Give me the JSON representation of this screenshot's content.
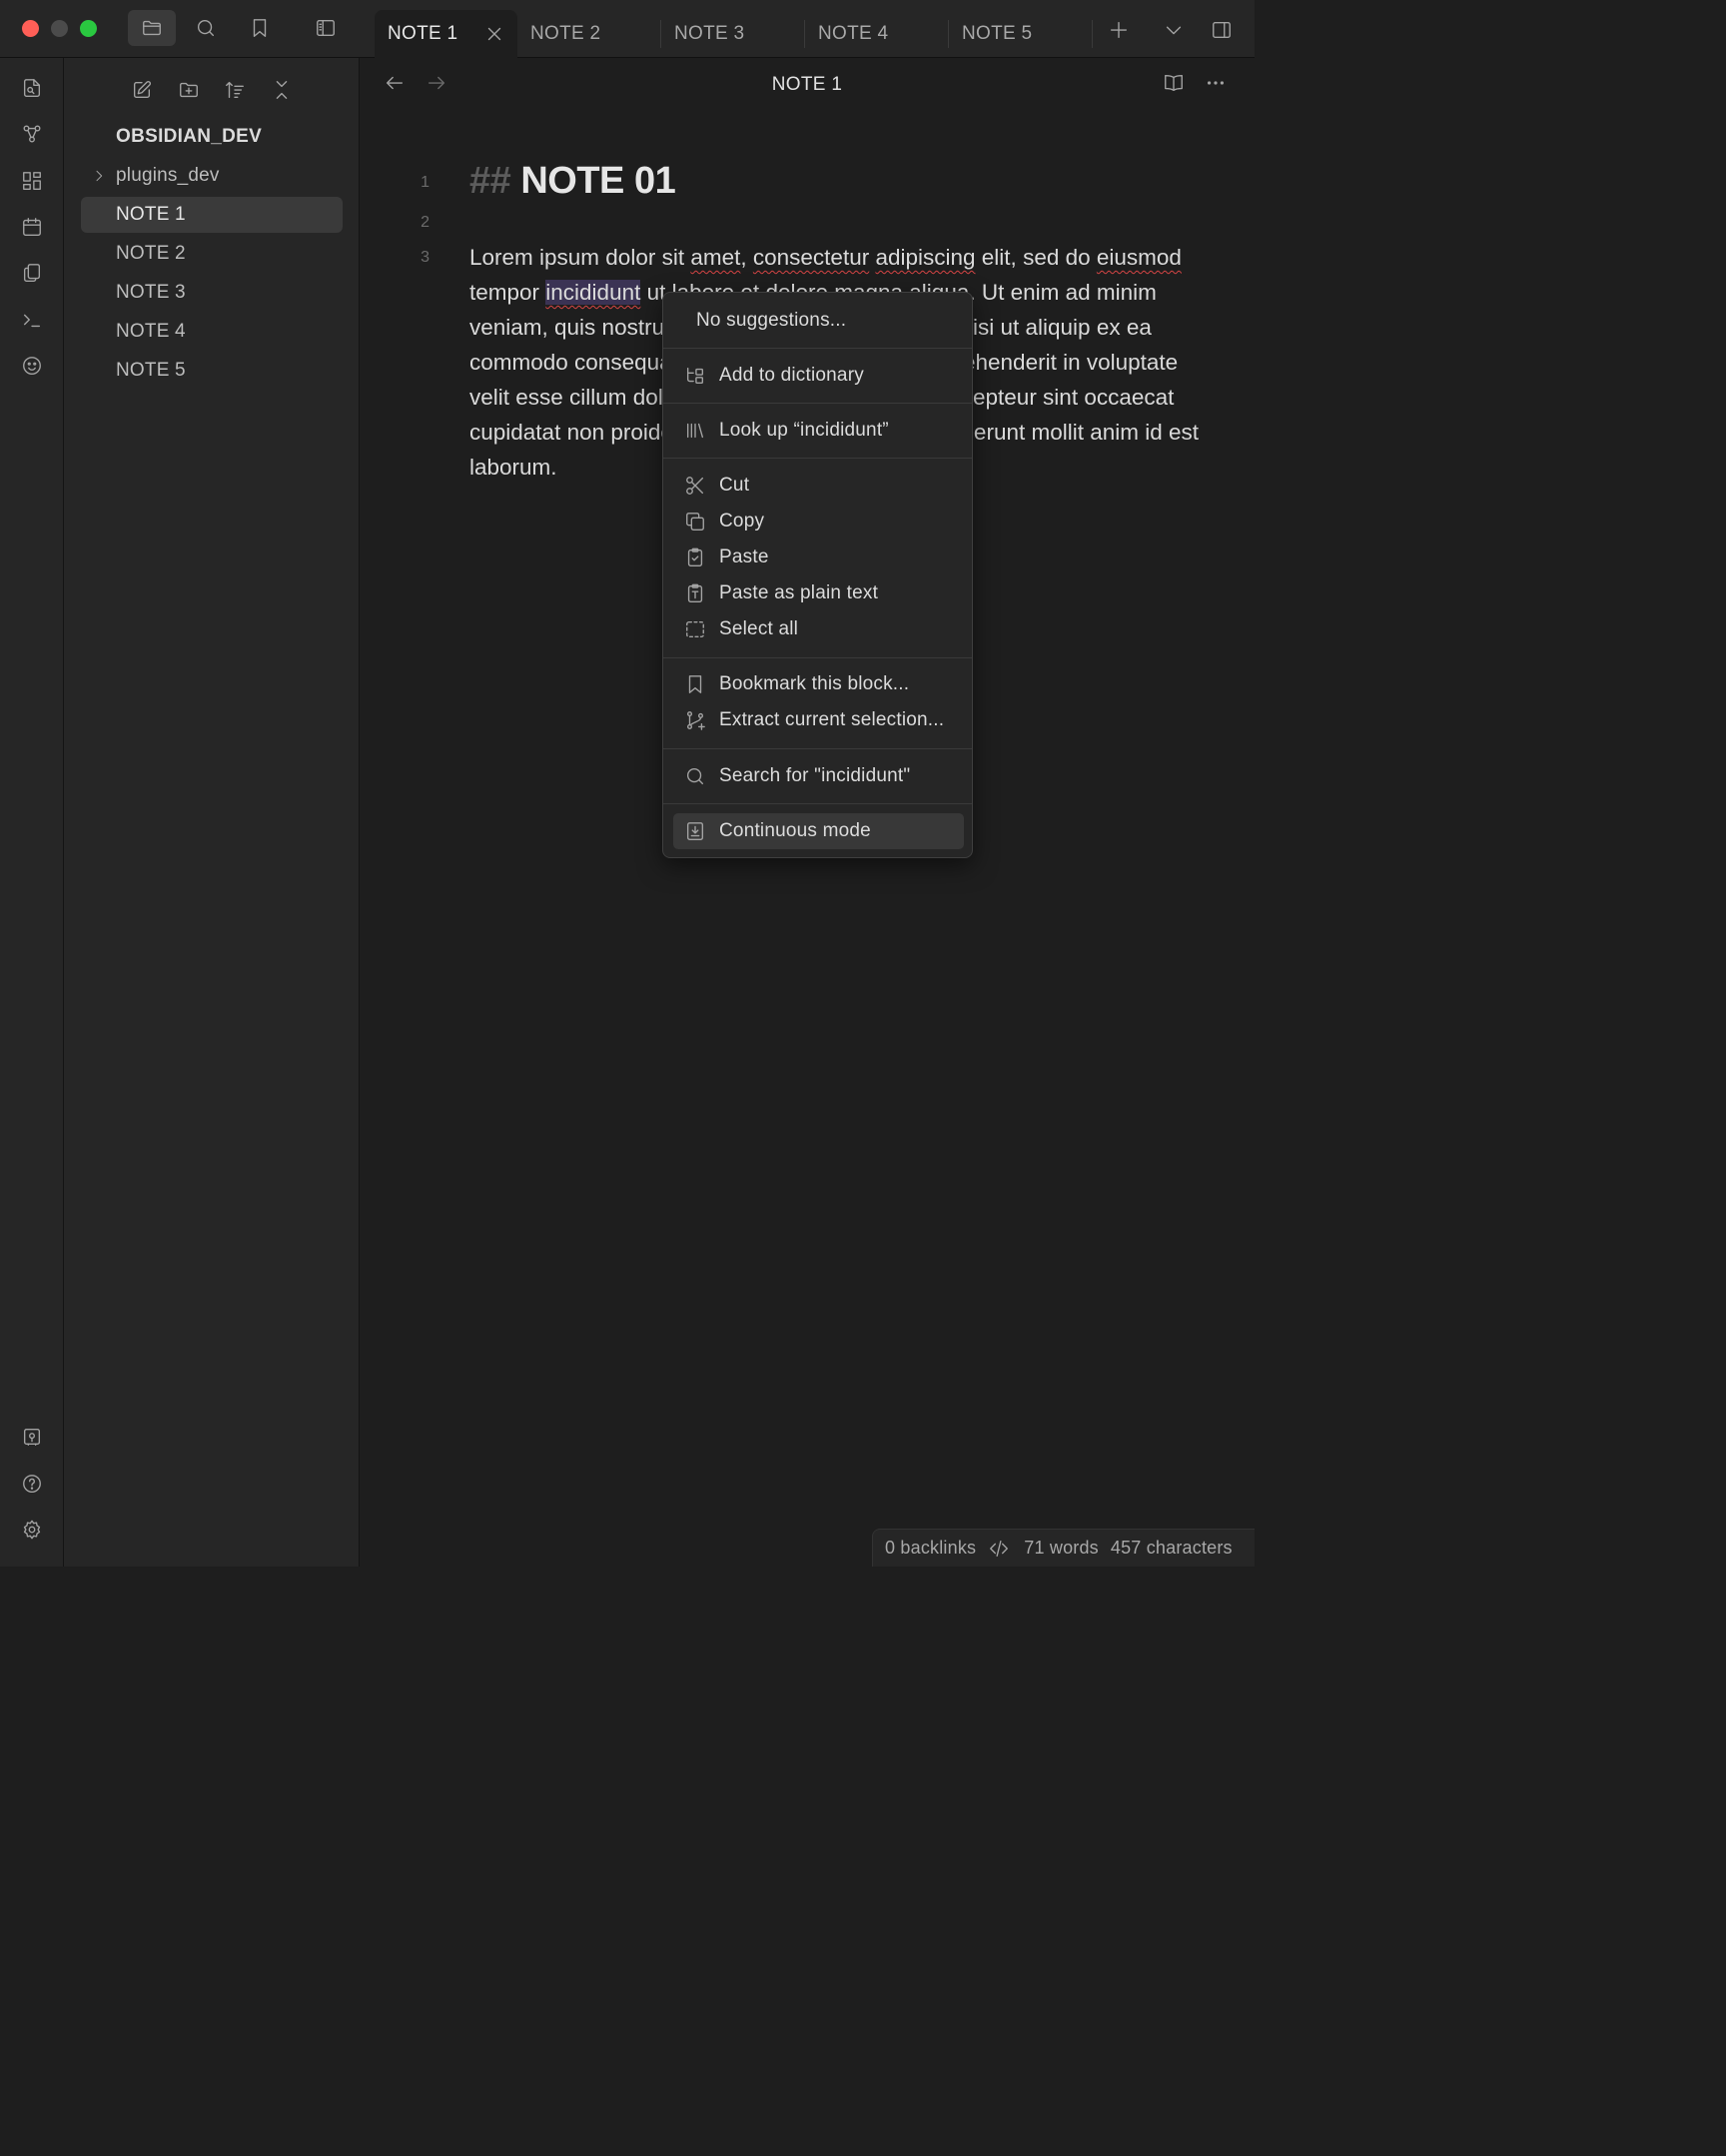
{
  "tabs": [
    {
      "label": "NOTE 1"
    },
    {
      "label": "NOTE 2"
    },
    {
      "label": "NOTE 3"
    },
    {
      "label": "NOTE 4"
    },
    {
      "label": "NOTE 5"
    }
  ],
  "sidebar": {
    "vault_name": "OBSIDIAN_DEV",
    "folder": "plugins_dev",
    "files": [
      "NOTE 1",
      "NOTE 2",
      "NOTE 3",
      "NOTE 4",
      "NOTE 5"
    ]
  },
  "editor": {
    "title": "NOTE 1",
    "line_numbers": [
      "1",
      "2",
      "3"
    ],
    "heading_marker": "##",
    "heading_text": "NOTE 01",
    "body": {
      "t1": "Lorem ipsum dolor sit ",
      "w_amet": "amet",
      "t2": ", ",
      "w_consectetur": "consectetur",
      "t3": " ",
      "w_adipiscing": "adipiscing",
      "t4": " elit, sed do ",
      "w_eiusmod": "eiusmod",
      "t5": " tempor ",
      "w_incididunt": "incididunt",
      "t6": " ut labore et dolore magna ",
      "w_aliqua": "aliqua",
      "t7": ". Ut enim ad minim veniam, quis nostrud exercitation ullamco laboris nisi ut aliquip ex ea commodo consequat. Duis aute irure dolor in reprehenderit in voluptate velit esse cillum dolore eu fugiat nulla pariatur. Excepteur sint occaecat cupidatat non proident, sunt in culpa qui officia deserunt mollit anim id est laborum."
    }
  },
  "context_menu": {
    "no_suggestions": "No suggestions...",
    "add_to_dictionary": "Add to dictionary",
    "look_up": "Look up “incididunt”",
    "cut": "Cut",
    "copy": "Copy",
    "paste": "Paste",
    "paste_plain": "Paste as plain text",
    "select_all": "Select all",
    "bookmark_block": "Bookmark this block...",
    "extract_selection": "Extract current selection...",
    "search_for": "Search for \"incididunt\"",
    "continuous_mode": "Continuous mode"
  },
  "status_bar": {
    "backlinks": "0 backlinks",
    "words": "71 words",
    "characters": "457 characters"
  },
  "icons": {
    "titlebar": [
      "folder-icon",
      "search-icon",
      "bookmark-icon",
      "sidebar-toggle-icon"
    ],
    "ribbon": [
      "quick-switcher-icon",
      "graph-view-icon",
      "canvas-icon",
      "daily-note-icon",
      "templates-icon",
      "command-palette-icon",
      "audio-recorder-icon",
      "vault-switcher-icon",
      "help-icon",
      "settings-icon"
    ]
  },
  "colors": {
    "background": "#1e1e1e",
    "panel": "#262626",
    "selection": "#3b3354",
    "spellcheck": "#d64545"
  }
}
